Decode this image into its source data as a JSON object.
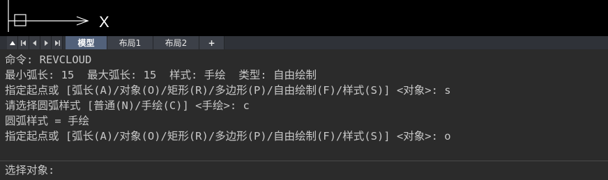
{
  "viewport": {
    "axis_label": "X",
    "background": "#000000",
    "axis_color": "#ffffff"
  },
  "layout_tabs": {
    "nav_icons": [
      "triangle-up-icon",
      "first-page-icon",
      "prev-page-icon",
      "next-page-icon",
      "last-page-icon"
    ],
    "tabs": [
      {
        "label": "模型",
        "active": true
      },
      {
        "label": "布局1",
        "active": false
      },
      {
        "label": "布局2",
        "active": false
      }
    ],
    "add_label": "+",
    "active_color": "#52617a"
  },
  "command_history": {
    "lines": [
      "命令: REVCLOUD",
      "最小弧长: 15  最大弧长: 15  样式: 手绘  类型: 自由绘制",
      "指定起点或 [弧长(A)/对象(O)/矩形(R)/多边形(P)/自由绘制(F)/样式(S)] <对象>: s",
      "请选择圆弧样式 [普通(N)/手绘(C)] <手绘>: c",
      "圆弧样式 = 手绘",
      "指定起点或 [弧长(A)/对象(O)/矩形(R)/多边形(P)/自由绘制(F)/样式(S)] <对象>: o"
    ],
    "text_color": "#c8c8c8"
  },
  "command_line": {
    "prompt": "选择对象:",
    "value": ""
  }
}
